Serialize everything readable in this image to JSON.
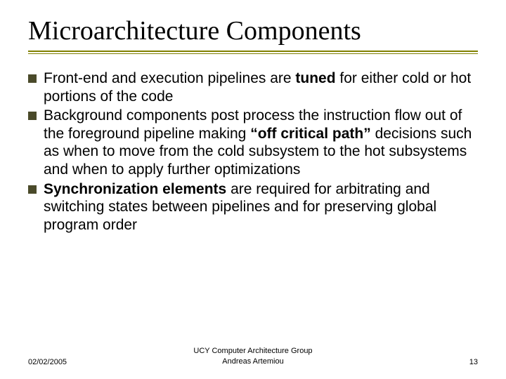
{
  "title": "Microarchitecture Components",
  "bullets": [
    {
      "runs": [
        {
          "t": "Front-end and execution pipelines are "
        },
        {
          "t": "tuned",
          "b": true
        },
        {
          "t": " for either cold or hot portions of the code"
        }
      ]
    },
    {
      "runs": [
        {
          "t": "Background components post process the instruction flow out of the foreground pipeline making "
        },
        {
          "t": "“off critical path”",
          "b": true
        },
        {
          "t": " decisions such as when to move from the cold subsystem to the hot subsystems and when to apply further optimizations"
        }
      ]
    },
    {
      "runs": [
        {
          "t": "Synchronization elements",
          "b": true
        },
        {
          "t": " are required for arbitrating and switching states between pipelines and for preserving global program order"
        }
      ]
    }
  ],
  "footer": {
    "date": "02/02/2005",
    "group_line1": "UCY Computer Architecture Group",
    "group_line2": "Andreas Artemiou",
    "page": "13"
  }
}
